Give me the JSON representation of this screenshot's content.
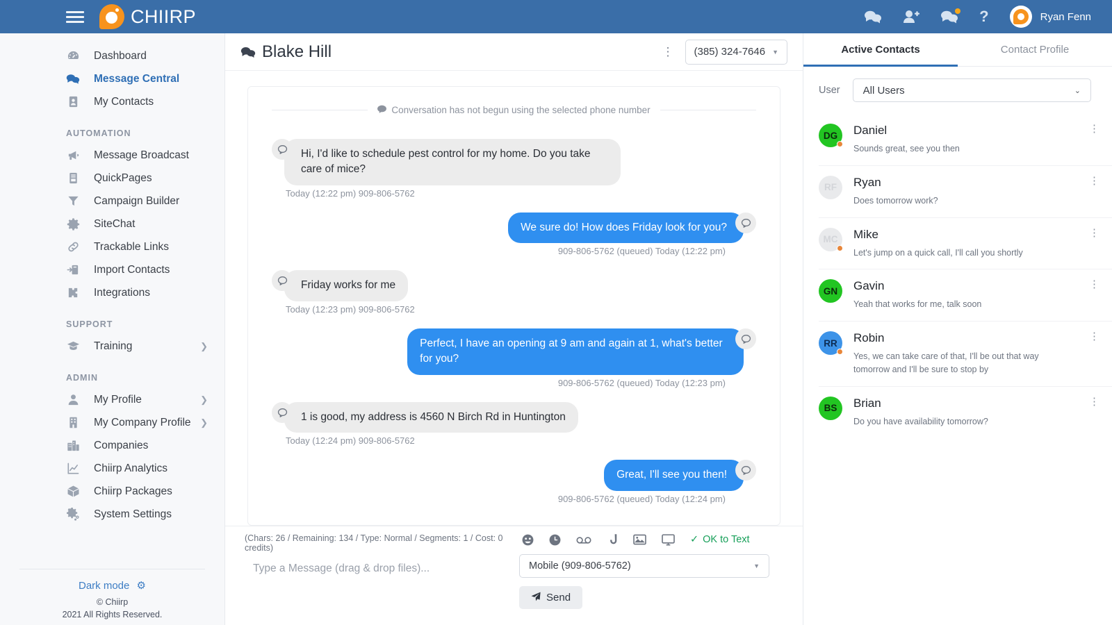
{
  "topbar": {
    "brand_name": "CHIIRP",
    "menu_icon": "hamburger-icon",
    "icons": [
      {
        "name": "messages-icon",
        "badge": false
      },
      {
        "name": "add-user-icon",
        "badge": false
      },
      {
        "name": "notifications-chat-icon",
        "badge": true
      },
      {
        "name": "help-icon",
        "badge": false
      }
    ],
    "help_label": "?",
    "user_name": "Ryan Fenn"
  },
  "sidebar": {
    "main_items": [
      {
        "label": "Dashboard",
        "icon": "dashboard-icon",
        "active": false,
        "chevron": false
      },
      {
        "label": "Message Central",
        "icon": "chat-bubbles-icon",
        "active": true,
        "chevron": false
      },
      {
        "label": "My Contacts",
        "icon": "contact-card-icon",
        "active": false,
        "chevron": false
      }
    ],
    "automation_title": "AUTOMATION",
    "automation_items": [
      {
        "label": "Message Broadcast",
        "icon": "megaphone-icon",
        "active": false,
        "chevron": false
      },
      {
        "label": "QuickPages",
        "icon": "page-icon",
        "active": false,
        "chevron": false
      },
      {
        "label": "Campaign Builder",
        "icon": "funnel-icon",
        "active": false,
        "chevron": false
      },
      {
        "label": "SiteChat",
        "icon": "gear-icon",
        "active": false,
        "chevron": false
      },
      {
        "label": "Trackable Links",
        "icon": "link-icon",
        "active": false,
        "chevron": false
      },
      {
        "label": "Import Contacts",
        "icon": "import-icon",
        "active": false,
        "chevron": false
      },
      {
        "label": "Integrations",
        "icon": "puzzle-icon",
        "active": false,
        "chevron": false
      }
    ],
    "support_title": "SUPPORT",
    "support_items": [
      {
        "label": "Training",
        "icon": "graduation-cap-icon",
        "active": false,
        "chevron": true
      }
    ],
    "admin_title": "ADMIN",
    "admin_items": [
      {
        "label": "My Profile",
        "icon": "person-icon",
        "active": false,
        "chevron": true
      },
      {
        "label": "My Company Profile",
        "icon": "building-icon",
        "active": false,
        "chevron": true
      },
      {
        "label": "Companies",
        "icon": "city-icon",
        "active": false,
        "chevron": false
      },
      {
        "label": "Chiirp Analytics",
        "icon": "chart-line-icon",
        "active": false,
        "chevron": false
      },
      {
        "label": "Chiirp Packages",
        "icon": "box-icon",
        "active": false,
        "chevron": false
      },
      {
        "label": "System Settings",
        "icon": "gears-icon",
        "active": false,
        "chevron": false
      }
    ],
    "dark_mode_label": "Dark mode",
    "dark_mode_icon": "gear-icon",
    "copyright_line1": "© Chiirp",
    "copyright_line2": "2021 All Rights Reserved."
  },
  "conversation": {
    "title": "Blake Hill",
    "title_icon": "chat-bubbles-icon",
    "kebab_icon": "vertical-dots-icon",
    "phone_number": "(385) 324-7646",
    "system_note": "Conversation has not begun using the selected phone number",
    "messages": [
      {
        "direction": "in",
        "text": "Hi, I'd like to schedule pest control for my home. Do you take care of mice?",
        "meta": "Today (12:22 pm) 909-806-5762"
      },
      {
        "direction": "out",
        "text": "We sure do! How does Friday look for you?",
        "meta": "909-806-5762 (queued) Today (12:22 pm)"
      },
      {
        "direction": "in",
        "text": "Friday works for me",
        "meta": "Today (12:23 pm) 909-806-5762"
      },
      {
        "direction": "out",
        "text": "Perfect, I have an opening at 9 am and again at 1, what's better for you?",
        "meta": "909-806-5762 (queued) Today (12:23 pm)"
      },
      {
        "direction": "in",
        "text": "1 is good, my address is 4560 N Birch Rd in Huntington",
        "meta": "Today (12:24 pm) 909-806-5762"
      },
      {
        "direction": "out",
        "text": "Great, I'll see you then!",
        "meta": "909-806-5762 (queued) Today (12:24 pm)"
      }
    ]
  },
  "composer": {
    "stats": "(Chars: 26 / Remaining: 134 / Type: Normal / Segments: 1 / Cost: 0 credits)",
    "placeholder": "Type a Message (drag & drop files)...",
    "icons": [
      {
        "name": "emoji-icon"
      },
      {
        "name": "clock-icon"
      },
      {
        "name": "voicemail-icon"
      },
      {
        "name": "phone-icon"
      },
      {
        "name": "image-icon"
      },
      {
        "name": "screen-icon"
      }
    ],
    "ok_to_text_label": "OK to Text",
    "ok_to_text_icon": "check-icon",
    "number_select_value": "Mobile (909-806-5762)",
    "send_label": "Send",
    "send_icon": "paper-plane-icon"
  },
  "right_panel": {
    "tabs": [
      {
        "label": "Active Contacts",
        "active": true
      },
      {
        "label": "Contact Profile",
        "active": false
      }
    ],
    "filter_label": "User",
    "filter_value": "All Users",
    "contacts": [
      {
        "name": "Daniel",
        "initials": "DG",
        "preview": "Sounds great, see you then",
        "avatar_color": "#22c522",
        "avatar_text_color": "#0c2a0c",
        "presence": true,
        "muted": false
      },
      {
        "name": "Ryan",
        "initials": "RF",
        "preview": "Does tomorrow work?",
        "avatar_color": "#e9eaec",
        "avatar_text_color": "#d3d5d9",
        "presence": false,
        "muted": true
      },
      {
        "name": "Mike",
        "initials": "MC",
        "preview": "Let's jump on a quick call, I'll call you shortly",
        "avatar_color": "#e9eaec",
        "avatar_text_color": "#d3d5d9",
        "presence": true,
        "muted": true
      },
      {
        "name": "Gavin",
        "initials": "GN",
        "preview": "Yeah that works for me, talk soon",
        "avatar_color": "#22c522",
        "avatar_text_color": "#0c2a0c",
        "presence": false,
        "muted": false
      },
      {
        "name": "Robin",
        "initials": "RR",
        "preview": "Yes, we can take care of that, I'll be out that way tomorrow and I'll be sure to stop by",
        "avatar_color": "#3d93e8",
        "avatar_text_color": "#0d2c52",
        "presence": true,
        "muted": false
      },
      {
        "name": "Brian",
        "initials": "BS",
        "preview": "Do you have availability tomorrow?",
        "avatar_color": "#22c522",
        "avatar_text_color": "#0c2a0c",
        "presence": false,
        "muted": false
      }
    ],
    "kebab_icon": "vertical-dots-icon"
  },
  "colors": {
    "header_blue": "#3a6ea8",
    "accent_blue": "#2f6fb5",
    "bubble_out": "#2f8ff0",
    "bubble_in": "#ececec",
    "brand_orange": "#f7931e",
    "ok_green": "#18a05a"
  }
}
